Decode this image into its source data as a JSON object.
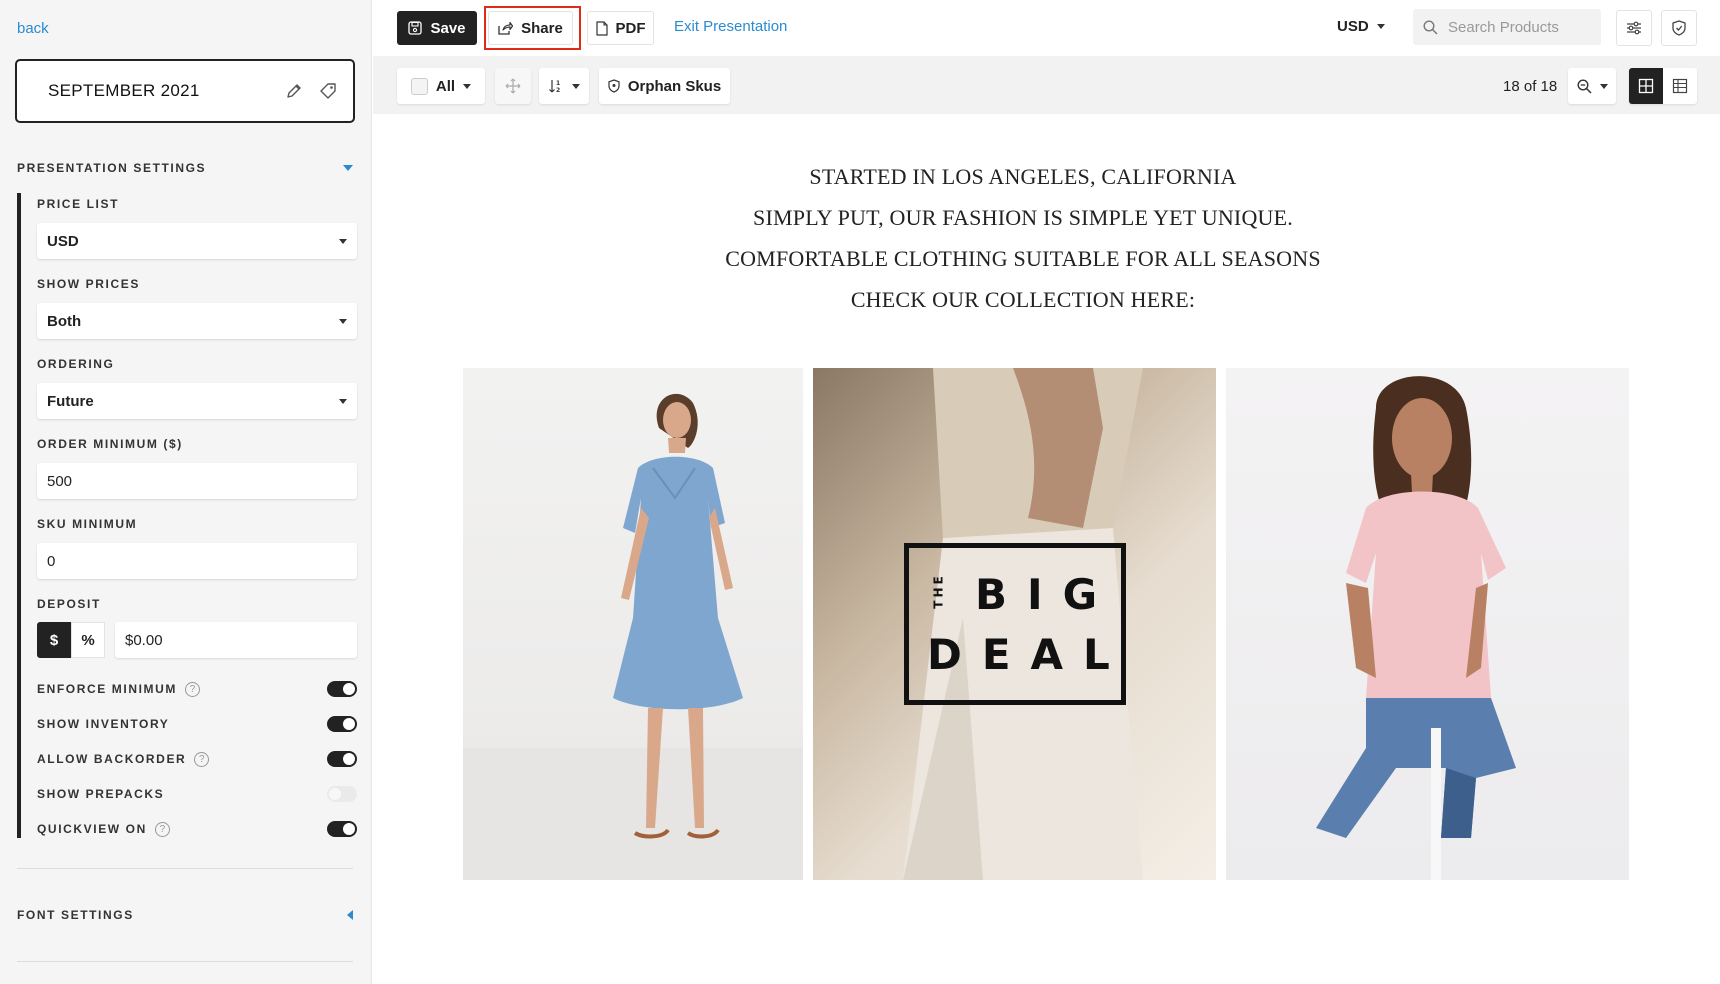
{
  "sidebar": {
    "back_label": "back",
    "presentation_title": "SEPTEMBER 2021",
    "presentation_settings_label": "PRESENTATION SETTINGS",
    "price_list": {
      "label": "PRICE LIST",
      "value": "USD"
    },
    "show_prices": {
      "label": "SHOW PRICES",
      "value": "Both"
    },
    "ordering": {
      "label": "ORDERING",
      "value": "Future"
    },
    "order_minimum": {
      "label": "ORDER MINIMUM ($)",
      "value": "500"
    },
    "sku_minimum": {
      "label": "SKU MINIMUM",
      "value": "0"
    },
    "deposit": {
      "label": "DEPOSIT",
      "dollar": "$",
      "percent": "%",
      "value": "$0.00"
    },
    "toggles": [
      {
        "label": "ENFORCE MINIMUM",
        "help": true,
        "on": true
      },
      {
        "label": "SHOW INVENTORY",
        "help": false,
        "on": true
      },
      {
        "label": "ALLOW BACKORDER",
        "help": true,
        "on": true
      },
      {
        "label": "SHOW PREPACKS",
        "help": false,
        "on": false
      },
      {
        "label": "QUICKVIEW ON",
        "help": true,
        "on": true
      }
    ],
    "font_settings_label": "FONT SETTINGS",
    "help_glyph": "?"
  },
  "topbar": {
    "save_label": "Save",
    "share_label": "Share",
    "pdf_label": "PDF",
    "exit_label": "Exit Presentation",
    "currency": "USD",
    "search_placeholder": "Search Products"
  },
  "toolbar": {
    "select_label": "All",
    "orphan_label": "Orphan Skus",
    "count": "18 of 18"
  },
  "content": {
    "intro_lines": [
      "STARTED IN LOS ANGELES, CALIFORNIA",
      "SIMPLY PUT, OUR FASHION IS SIMPLE YET UNIQUE.",
      "COMFORTABLE CLOTHING SUITABLE FOR ALL SEASONS",
      "CHECK OUR COLLECTION HERE:"
    ],
    "banner": {
      "the": "THE",
      "big": "BIG",
      "deal": "DEAL"
    }
  },
  "colors": {
    "accent": "#2a8bd1",
    "dark": "#222222",
    "highlight": "#e02a1a"
  }
}
